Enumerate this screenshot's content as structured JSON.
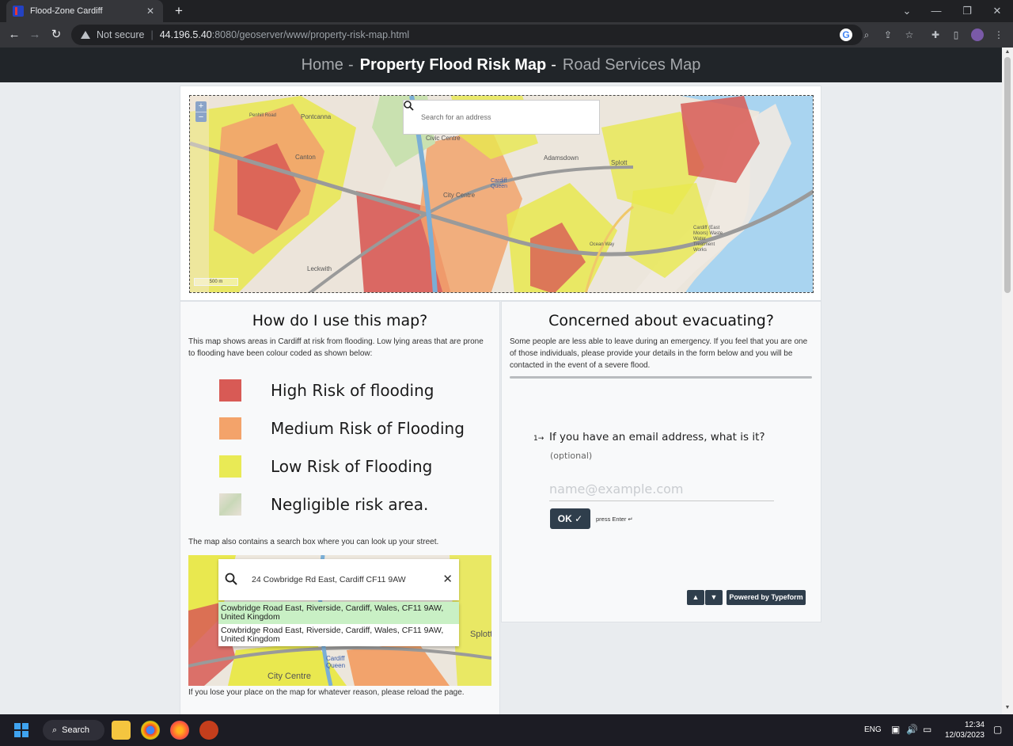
{
  "browser": {
    "tab_title": "Flood-Zone Cardiff",
    "tab_close": "✕",
    "new_tab": "+",
    "not_secure": "Not secure",
    "url_host": "44.196.5.40",
    "url_path": ":8080/geoserver/www/property-risk-map.html"
  },
  "site_nav": {
    "home": "Home",
    "separator": "-",
    "property_map": "Property Flood Risk Map",
    "road_map": "Road Services Map"
  },
  "map": {
    "search_placeholder": "Search for an address",
    "zoom_in": "+",
    "zoom_out": "−",
    "scale": "500 m",
    "labels": {
      "pontcanna": "Pontcanna",
      "civic_centre": "Civic Centre",
      "adamsdown": "Adamsdown",
      "splott": "Splott",
      "city_centre": "City Centre",
      "canton": "Canton",
      "cardiff_queen": "Cardiff Queen",
      "east_moors": "Cardiff (East Moors) Waste Water Treatment Works",
      "leckwith": "Leckwith",
      "ocean_way": "Ocean Way",
      "penhill_road": "Penhill Road"
    }
  },
  "how_to": {
    "heading": "How do I use this map?",
    "intro": "This map shows areas in Cardiff at risk from flooding. Low lying areas that are prone to flooding have been colour coded as shown below:",
    "legend": [
      {
        "label": "High Risk of flooding",
        "color": "#d85a55"
      },
      {
        "label": "Medium Risk of Flooding",
        "color": "#f3a36a"
      },
      {
        "label": "Low Risk of Flooding",
        "color": "#e9ea55"
      },
      {
        "label": "Negligible risk area.",
        "color": "#e8e0d6"
      }
    ],
    "search_note": "The map also contains a search box where you can look up your street.",
    "demo_query": "24 Cowbridge Rd East, Cardiff CF11 9AW",
    "demo_clear": "✕",
    "demo_results": [
      "Cowbridge Road East, Riverside, Cardiff, Wales, CF11 9AW, United Kingdom",
      "Cowbridge Road East, Riverside, Cardiff, Wales, CF11 9AW, United Kingdom"
    ],
    "demo_labels": {
      "city_centre": "City Centre",
      "splott": "Splott",
      "cardiff_queen": "Cardiff Queen"
    },
    "reload_note": "If you lose your place on the map for whatever reason, please reload the page."
  },
  "evacuation": {
    "heading": "Concerned about evacuating?",
    "intro": "Some people are less able to leave during an emergency. If you feel that you are one of those individuals, please provide your details in the form below and you will be contacted in the event of a severe flood.",
    "question_number": "1→",
    "question": "If you have an email address, what is it?",
    "optional": "(optional)",
    "email_placeholder": "name@example.com",
    "ok_label": "OK ✓",
    "enter_hint": "press Enter ↵",
    "up": "▲",
    "down": "▼",
    "powered_by": "Powered by Typeform"
  },
  "taskbar": {
    "search": "Search",
    "language": "ENG",
    "time": "12:34",
    "date": "12/03/2023"
  }
}
